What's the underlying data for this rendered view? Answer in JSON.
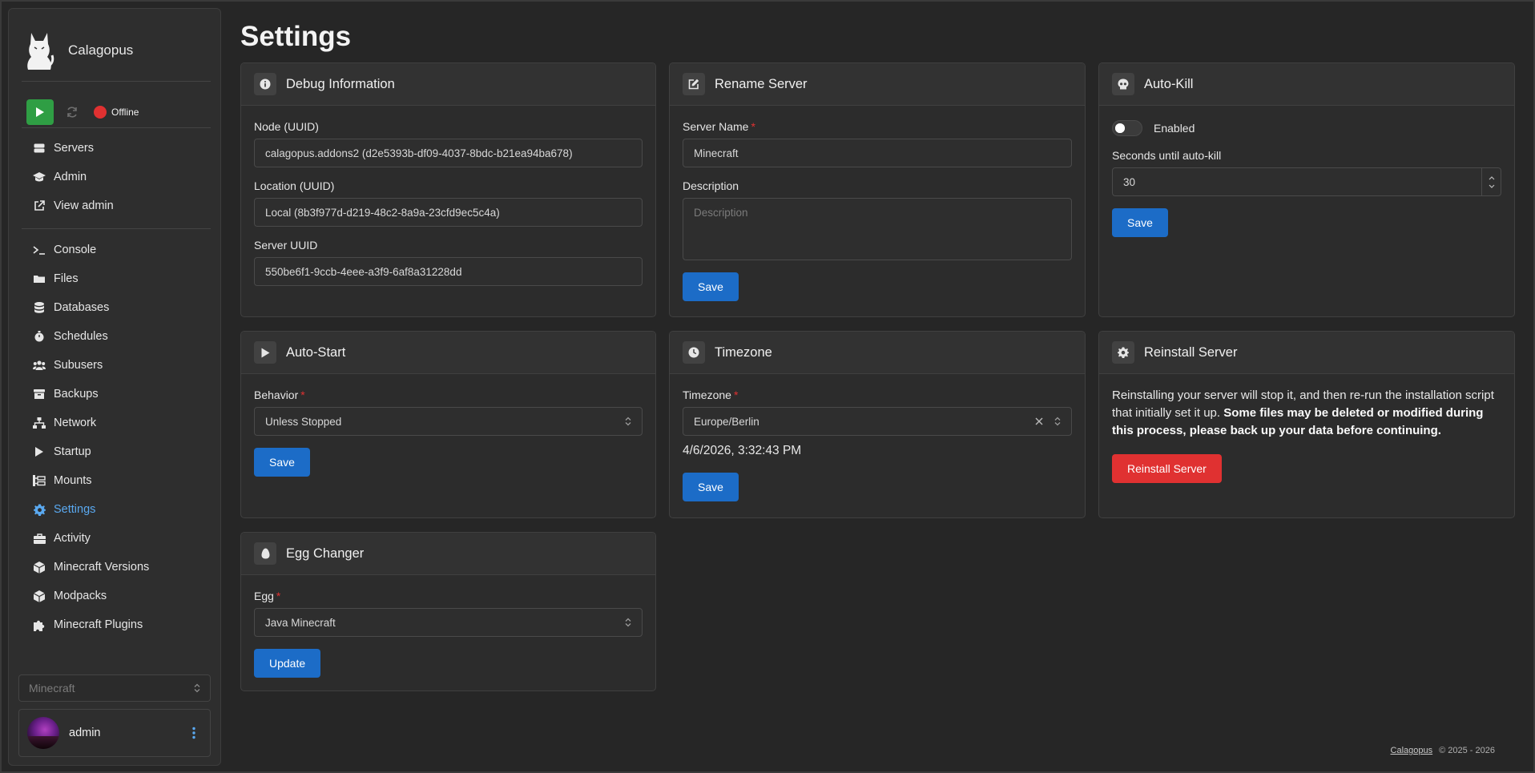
{
  "sidebar": {
    "brand": "Calagopus",
    "status": "Offline",
    "nav_top": [
      {
        "label": "Servers",
        "icon": "servers-icon"
      },
      {
        "label": "Admin",
        "icon": "admin-icon"
      },
      {
        "label": "View admin",
        "icon": "external-link-icon"
      }
    ],
    "nav_server": [
      {
        "label": "Console",
        "icon": "terminal-icon"
      },
      {
        "label": "Files",
        "icon": "folder-icon"
      },
      {
        "label": "Databases",
        "icon": "database-icon"
      },
      {
        "label": "Schedules",
        "icon": "stopwatch-icon"
      },
      {
        "label": "Subusers",
        "icon": "users-icon"
      },
      {
        "label": "Backups",
        "icon": "archive-icon"
      },
      {
        "label": "Network",
        "icon": "network-icon"
      },
      {
        "label": "Startup",
        "icon": "play-icon"
      },
      {
        "label": "Mounts",
        "icon": "mounts-icon"
      },
      {
        "label": "Settings",
        "icon": "gear-icon",
        "active": true
      },
      {
        "label": "Activity",
        "icon": "briefcase-icon"
      },
      {
        "label": "Minecraft Versions",
        "icon": "cube-icon"
      },
      {
        "label": "Modpacks",
        "icon": "cube-icon"
      },
      {
        "label": "Minecraft Plugins",
        "icon": "puzzle-icon"
      }
    ],
    "server_select": "Minecraft",
    "user": "admin"
  },
  "page": {
    "title": "Settings"
  },
  "debug": {
    "title": "Debug Information",
    "node_label": "Node (UUID)",
    "node_value": "calagopus.addons2 (d2e5393b-df09-4037-8bdc-b21ea94ba678)",
    "location_label": "Location (UUID)",
    "location_value": "Local (8b3f977d-d219-48c2-8a9a-23cfd9ec5c4a)",
    "uuid_label": "Server UUID",
    "uuid_value": "550be6f1-9ccb-4eee-a3f9-6af8a31228dd"
  },
  "rename": {
    "title": "Rename Server",
    "name_label": "Server Name",
    "name_value": "Minecraft",
    "desc_label": "Description",
    "desc_placeholder": "Description",
    "save": "Save"
  },
  "autokill": {
    "title": "Auto-Kill",
    "enabled_label": "Enabled",
    "enabled": false,
    "seconds_label": "Seconds until auto-kill",
    "seconds_value": "30",
    "save": "Save"
  },
  "autostart": {
    "title": "Auto-Start",
    "behavior_label": "Behavior",
    "behavior_value": "Unless Stopped",
    "save": "Save"
  },
  "timezone": {
    "title": "Timezone",
    "tz_label": "Timezone",
    "tz_value": "Europe/Berlin",
    "current_time": "4/6/2026, 3:32:43 PM",
    "save": "Save"
  },
  "reinstall": {
    "title": "Reinstall Server",
    "text_plain": "Reinstalling your server will stop it, and then re-run the installation script that initially set it up. ",
    "text_bold": "Some files may be deleted or modified during this process, please back up your data before continuing.",
    "button": "Reinstall Server"
  },
  "egg": {
    "title": "Egg Changer",
    "egg_label": "Egg",
    "egg_value": "Java Minecraft",
    "update": "Update"
  },
  "footer": {
    "link": "Calagopus",
    "copyright": "© 2025 - 2026"
  },
  "colors": {
    "accent": "#1c6cc7",
    "active_nav": "#5aa9f0",
    "danger": "#e03131",
    "success": "#2f9e44"
  }
}
